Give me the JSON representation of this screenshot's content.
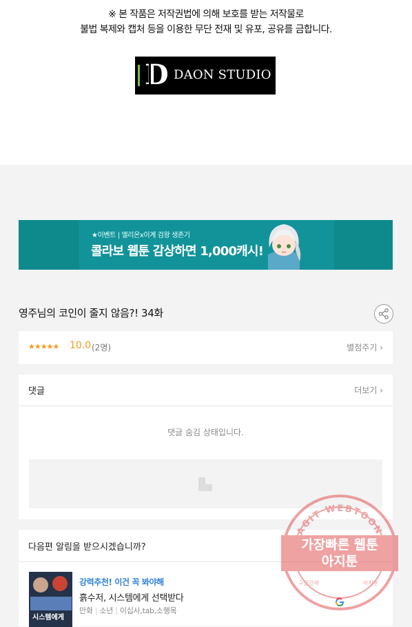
{
  "copyright": {
    "line1": "※ 본 작품은 저작권법에 의해 보호를 받는 저작물로",
    "line2": "불법 복제와 캡처 등을 이용한 무단 전재 및 유포, 공유를 금합니다."
  },
  "logo": {
    "letter": "D",
    "name": "DAON STUDIO"
  },
  "banner": {
    "sub": "★이벤트 | 엘리온x이계 검왕 생존기",
    "main": "콜라보 웹툰 감상하면 1,000캐시!"
  },
  "episode": {
    "title": "영주님의 코인이 줄지 않음?! 34화"
  },
  "rating": {
    "stars": "★★★★★",
    "score": "10.0",
    "count": "(2명)",
    "action": "별점주기 ›"
  },
  "comments": {
    "title": "댓글",
    "more": "더보기 ›",
    "hidden_text": "댓글 숨김 상태입니다."
  },
  "notify": {
    "title": "다음편 알림을 받으시겠습니까?",
    "thumb_text": "시스템에게",
    "recommend_tag": "강력추천! 이건 꼭 봐야해",
    "recommend_title": "흙수저, 시스템에게 선택받다",
    "meta": [
      "만화",
      "소년",
      "이십사,tab,소행목"
    ]
  },
  "watermark": {
    "arc_text": "AGIT WEBTOON",
    "line1": "가장빠른 웹툰",
    "line2": "아지툰",
    "left_small": "구글검색",
    "right_small": "아지툰"
  },
  "colors": {
    "banner_bg": "#0f8a8c",
    "rating_accent": "#f39a1b",
    "recommend_accent": "#2f83d6",
    "watermark": "#e04848"
  }
}
